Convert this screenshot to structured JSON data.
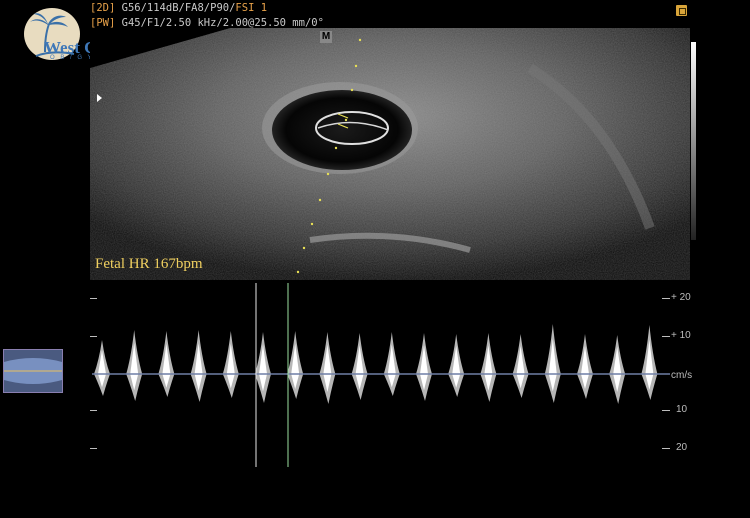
{
  "logo": {
    "brand": "West Coast",
    "sub": "O B / G Y N, Inc."
  },
  "header": {
    "line1_tag": "[2D]",
    "line1_params": "G56/114dB/FA8/P90/",
    "line1_fsi": "FSI 1",
    "line2_tag": "[PW]",
    "line2_params": "G45/F1/2.50 kHz/2.00@25.50 mm/0°"
  },
  "marker": "M",
  "measurement": {
    "label": "Fetal HR 167bpm"
  },
  "doppler_scale": {
    "unit": "cm/s",
    "ticks": [
      "+ 20",
      "+ 10",
      "10",
      "20"
    ]
  },
  "colors": {
    "annotation": "#f0d060",
    "header_tag": "#e8a24a",
    "logo": "#3f78b8"
  }
}
